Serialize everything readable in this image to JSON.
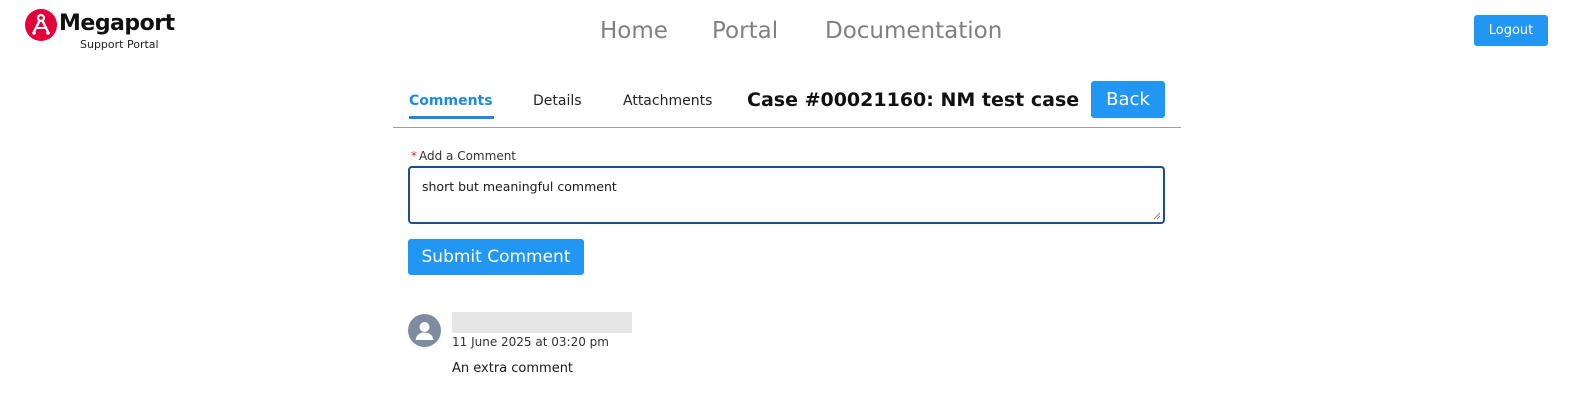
{
  "brand": {
    "name": "Megaport",
    "subtitle": "Support Portal",
    "accent": "#e4003b"
  },
  "nav": {
    "items": [
      {
        "label": "Home"
      },
      {
        "label": "Portal"
      },
      {
        "label": "Documentation"
      }
    ],
    "logout_label": "Logout"
  },
  "case": {
    "tabs": [
      {
        "label": "Comments",
        "active": true
      },
      {
        "label": "Details",
        "active": false
      },
      {
        "label": "Attachments",
        "active": false
      }
    ],
    "title": "Case #00021160: NM test case",
    "back_label": "Back"
  },
  "comment_form": {
    "required_marker": "*",
    "label": "Add a Comment",
    "value": "short but meaningful comment",
    "submit_label": "Submit Comment"
  },
  "comments": [
    {
      "avatar_icon": "user-icon",
      "date": "11 June 2025 at 03:20 pm",
      "text": "An extra comment"
    }
  ],
  "colors": {
    "primary": "#2196f3",
    "active_tab": "#1e88e5",
    "required": "#d32f2f",
    "focus_border": "#1d4f8a"
  }
}
